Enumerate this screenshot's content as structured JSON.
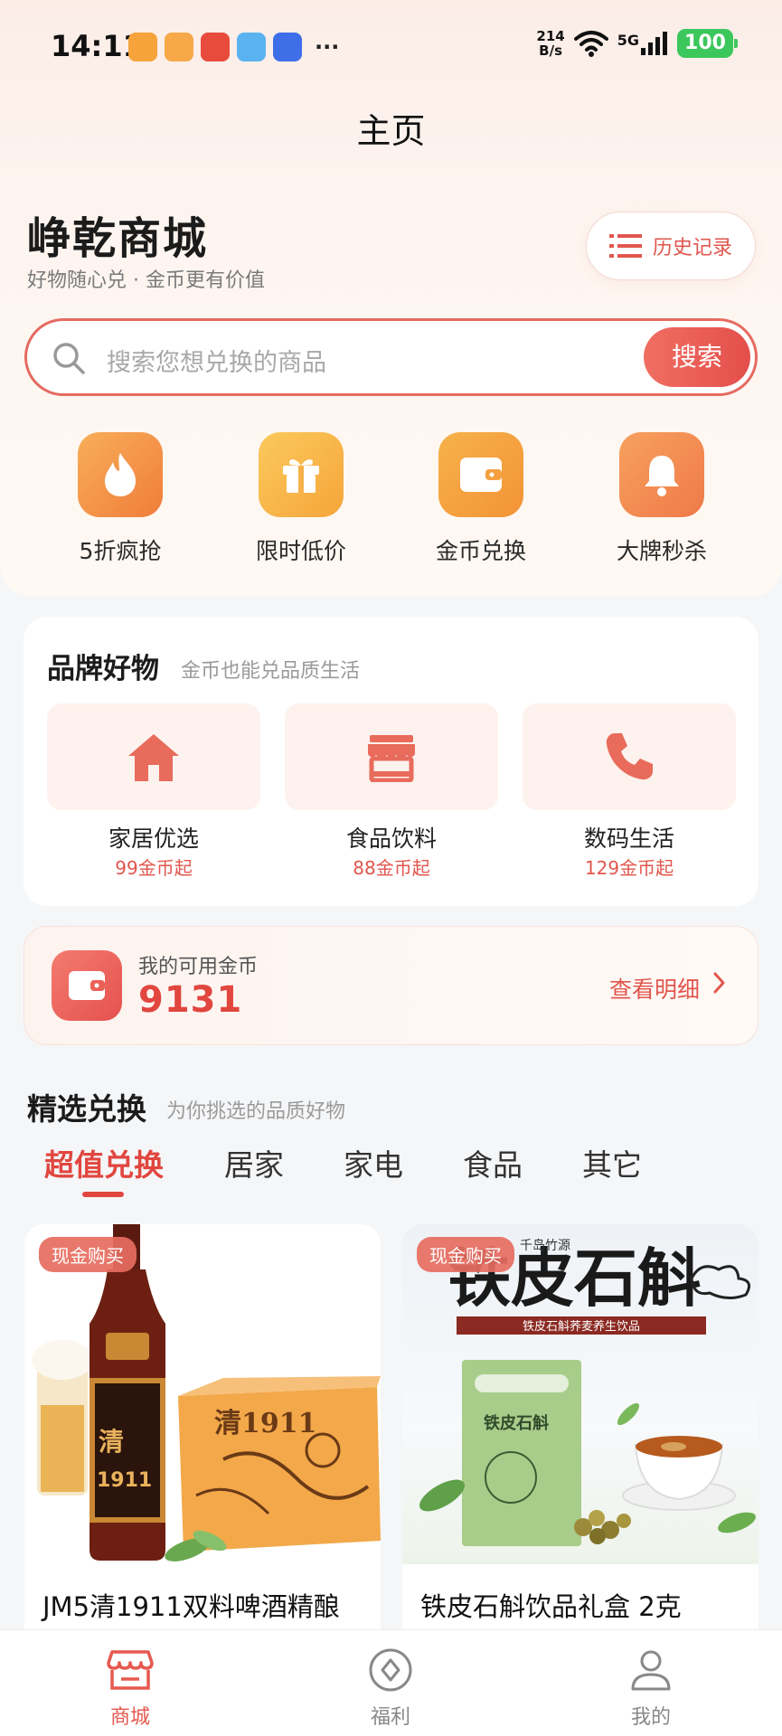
{
  "status_bar": {
    "time": "14:11",
    "net_speed_top": "214",
    "net_speed_bottom": "B/s",
    "signal": "5G",
    "battery": "100"
  },
  "header": {
    "title": "主页"
  },
  "brand": {
    "name": "峥乾商城",
    "slogan": "好物随心兑 · 金币更有价值",
    "history_label": "历史记录"
  },
  "search": {
    "placeholder": "搜索您想兑换的商品",
    "button_label": "搜索"
  },
  "quick_entries": [
    {
      "label": "5折疯抢",
      "icon": "flame-icon"
    },
    {
      "label": "限时低价",
      "icon": "gift-icon"
    },
    {
      "label": "金币兑换",
      "icon": "wallet-icon"
    },
    {
      "label": "大牌秒杀",
      "icon": "bell-icon"
    }
  ],
  "brand_goods": {
    "title": "品牌好物",
    "subtitle": "金币也能兑品质生活",
    "categories": [
      {
        "name": "家居优选",
        "price": "99金币起",
        "icon": "home-icon"
      },
      {
        "name": "食品饮料",
        "price": "88金币起",
        "icon": "store-icon"
      },
      {
        "name": "数码生活",
        "price": "129金币起",
        "icon": "phone-icon"
      }
    ]
  },
  "coins": {
    "label": "我的可用金币",
    "value": "9131",
    "detail_label": "查看明细"
  },
  "featured": {
    "title": "精选兑换",
    "subtitle": "为你挑选的品质好物",
    "tabs": [
      {
        "label": "超值兑换",
        "active": true
      },
      {
        "label": "居家",
        "active": false
      },
      {
        "label": "家电",
        "active": false
      },
      {
        "label": "食品",
        "active": false
      },
      {
        "label": "其它",
        "active": false
      }
    ],
    "products": [
      {
        "tag": "现金购买",
        "name": "JM5清1911双料啤酒精酿"
      },
      {
        "tag": "现金购买",
        "name": "铁皮石斛饮品礼盒 2克",
        "image_text": "铁皮石斛",
        "image_brand": "千岛竹源",
        "image_banner": "铁皮石斛荞麦养生饮品"
      }
    ]
  },
  "bottom_nav": [
    {
      "label": "商城",
      "active": true
    },
    {
      "label": "福利",
      "active": false
    },
    {
      "label": "我的",
      "active": false
    }
  ],
  "colors": {
    "accent": "#e1463f",
    "orange": "#f49a3c",
    "search_border": "#e56a60"
  }
}
